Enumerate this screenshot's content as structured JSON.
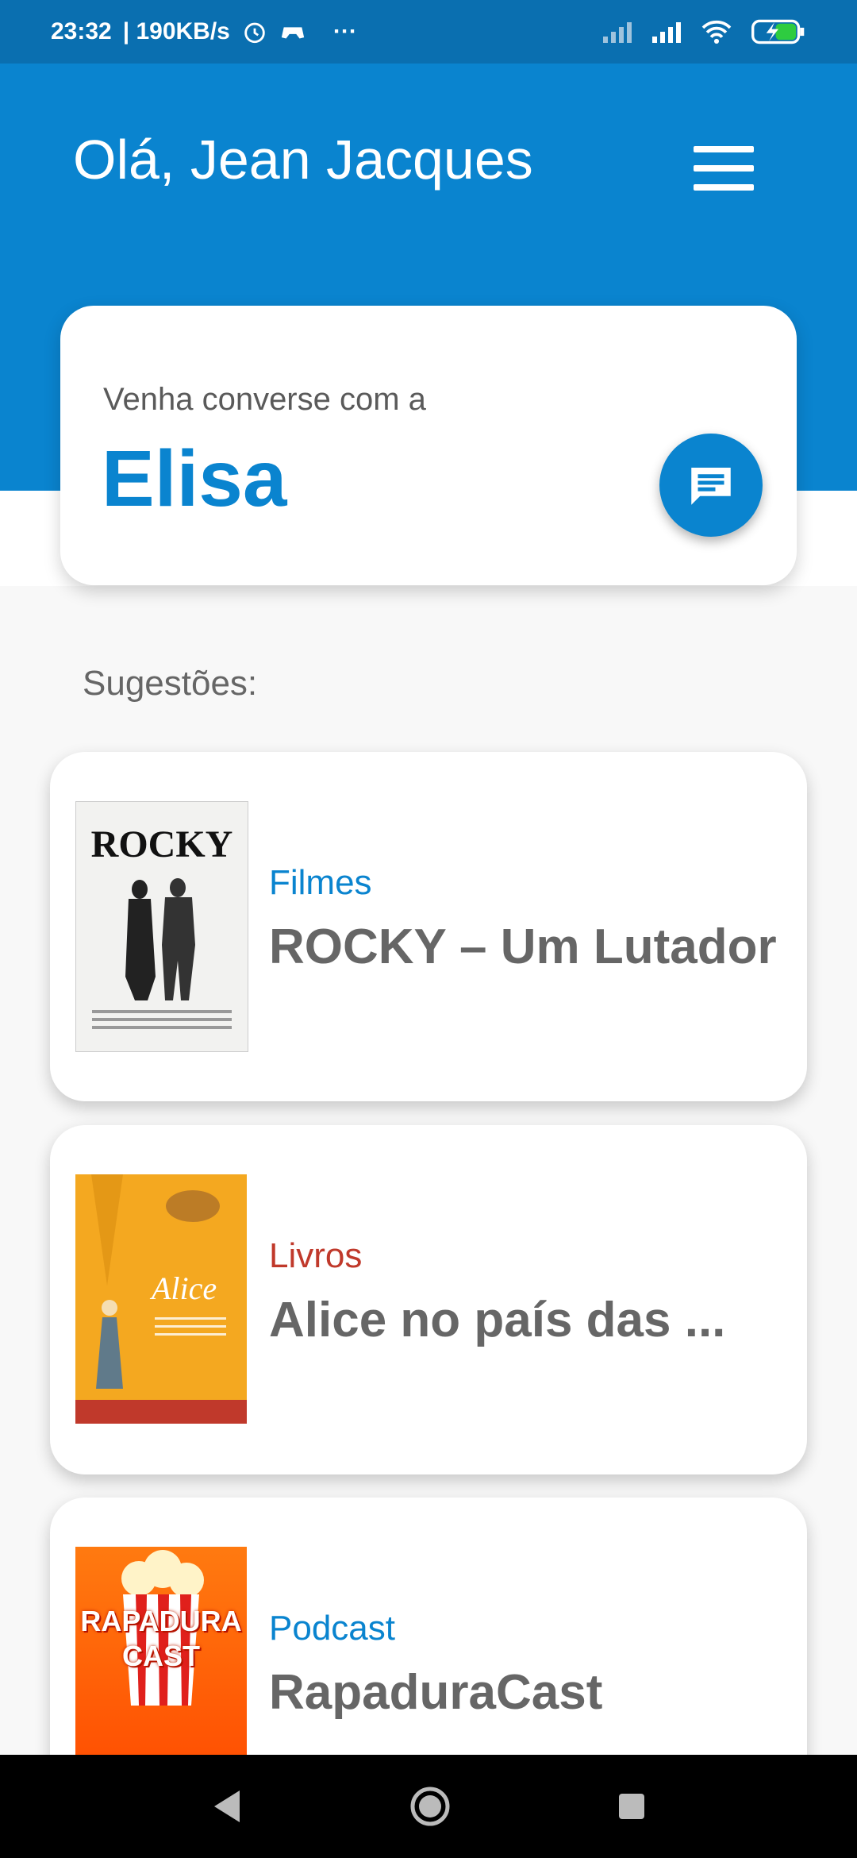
{
  "status_bar": {
    "time": "23:32",
    "speed": "| 190KB/s",
    "more": "···",
    "icons": [
      "alarm-icon",
      "game-controller-icon",
      "signal-icon",
      "signal-icon",
      "wifi-icon",
      "battery-charging-icon"
    ]
  },
  "header": {
    "greeting": "Olá, Jean Jacques",
    "menu_icon": "hamburger-menu-icon"
  },
  "elisa_card": {
    "subtitle": "Venha converse com a",
    "name": "Elisa",
    "chat_icon": "chat-message-icon"
  },
  "suggestions": {
    "label": "Sugestões:",
    "items": [
      {
        "category": "Filmes",
        "category_color": "#0a84cf",
        "title": "ROCKY – Um Lutador",
        "poster_text": "ROCKY"
      },
      {
        "category": "Livros",
        "category_color": "#c0392b",
        "title": "Alice no país das ...",
        "poster_text": "Alice"
      },
      {
        "category": "Podcast",
        "category_color": "#0a84cf",
        "title": "RapaduraCast",
        "poster_text": "RAPADURA CAST"
      }
    ]
  },
  "colors": {
    "primary": "#0a84cf",
    "status_bar": "#0a6fb0",
    "books_accent": "#c0392b"
  },
  "nav": [
    "back-icon",
    "home-icon",
    "recents-icon"
  ]
}
